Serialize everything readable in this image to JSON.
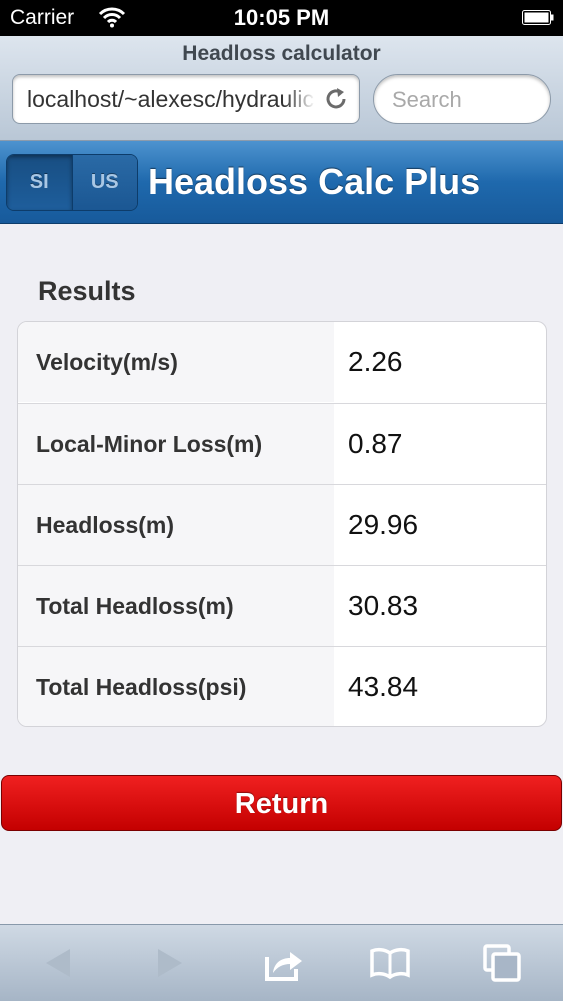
{
  "status_bar": {
    "carrier": "Carrier",
    "time": "10:05 PM"
  },
  "browser": {
    "page_title": "Headloss calculator",
    "url": "localhost/~alexesc/hydraulics",
    "search_placeholder": "Search"
  },
  "header": {
    "units": [
      "SI",
      "US"
    ],
    "selected_unit": "SI",
    "title": "Headloss Calc Plus"
  },
  "results": {
    "heading": "Results",
    "rows": [
      {
        "label": "Velocity(m/s)",
        "value": "2.26"
      },
      {
        "label": "Local-Minor Loss(m)",
        "value": "0.87"
      },
      {
        "label": "Headloss(m)",
        "value": "29.96"
      },
      {
        "label": "Total Headloss(m)",
        "value": "30.83"
      },
      {
        "label": "Total Headloss(psi)",
        "value": "43.84"
      }
    ]
  },
  "return_button": {
    "label": "Return",
    "color": "#d40000"
  },
  "toolbar": {
    "icons": [
      "back-icon",
      "forward-icon",
      "share-icon",
      "bookmarks-icon",
      "tabs-icon"
    ]
  },
  "colors": {
    "header_blue": "#1f69ad",
    "return_red": "#d40000"
  }
}
